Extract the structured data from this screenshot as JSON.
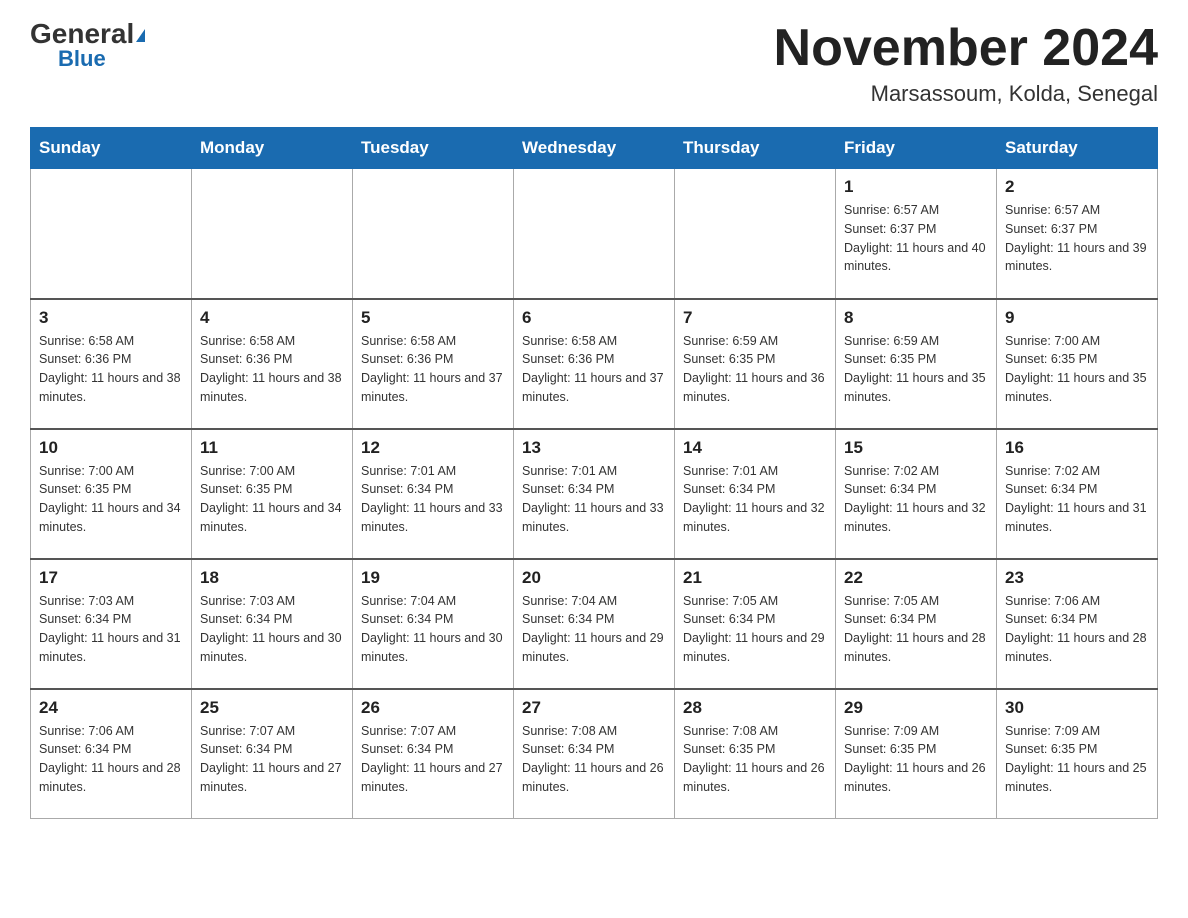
{
  "header": {
    "logo_general": "General",
    "logo_blue": "Blue",
    "title": "November 2024",
    "subtitle": "Marsassoum, Kolda, Senegal"
  },
  "days_of_week": [
    "Sunday",
    "Monday",
    "Tuesday",
    "Wednesday",
    "Thursday",
    "Friday",
    "Saturday"
  ],
  "weeks": [
    [
      {
        "day": "",
        "info": ""
      },
      {
        "day": "",
        "info": ""
      },
      {
        "day": "",
        "info": ""
      },
      {
        "day": "",
        "info": ""
      },
      {
        "day": "",
        "info": ""
      },
      {
        "day": "1",
        "info": "Sunrise: 6:57 AM\nSunset: 6:37 PM\nDaylight: 11 hours and 40 minutes."
      },
      {
        "day": "2",
        "info": "Sunrise: 6:57 AM\nSunset: 6:37 PM\nDaylight: 11 hours and 39 minutes."
      }
    ],
    [
      {
        "day": "3",
        "info": "Sunrise: 6:58 AM\nSunset: 6:36 PM\nDaylight: 11 hours and 38 minutes."
      },
      {
        "day": "4",
        "info": "Sunrise: 6:58 AM\nSunset: 6:36 PM\nDaylight: 11 hours and 38 minutes."
      },
      {
        "day": "5",
        "info": "Sunrise: 6:58 AM\nSunset: 6:36 PM\nDaylight: 11 hours and 37 minutes."
      },
      {
        "day": "6",
        "info": "Sunrise: 6:58 AM\nSunset: 6:36 PM\nDaylight: 11 hours and 37 minutes."
      },
      {
        "day": "7",
        "info": "Sunrise: 6:59 AM\nSunset: 6:35 PM\nDaylight: 11 hours and 36 minutes."
      },
      {
        "day": "8",
        "info": "Sunrise: 6:59 AM\nSunset: 6:35 PM\nDaylight: 11 hours and 35 minutes."
      },
      {
        "day": "9",
        "info": "Sunrise: 7:00 AM\nSunset: 6:35 PM\nDaylight: 11 hours and 35 minutes."
      }
    ],
    [
      {
        "day": "10",
        "info": "Sunrise: 7:00 AM\nSunset: 6:35 PM\nDaylight: 11 hours and 34 minutes."
      },
      {
        "day": "11",
        "info": "Sunrise: 7:00 AM\nSunset: 6:35 PM\nDaylight: 11 hours and 34 minutes."
      },
      {
        "day": "12",
        "info": "Sunrise: 7:01 AM\nSunset: 6:34 PM\nDaylight: 11 hours and 33 minutes."
      },
      {
        "day": "13",
        "info": "Sunrise: 7:01 AM\nSunset: 6:34 PM\nDaylight: 11 hours and 33 minutes."
      },
      {
        "day": "14",
        "info": "Sunrise: 7:01 AM\nSunset: 6:34 PM\nDaylight: 11 hours and 32 minutes."
      },
      {
        "day": "15",
        "info": "Sunrise: 7:02 AM\nSunset: 6:34 PM\nDaylight: 11 hours and 32 minutes."
      },
      {
        "day": "16",
        "info": "Sunrise: 7:02 AM\nSunset: 6:34 PM\nDaylight: 11 hours and 31 minutes."
      }
    ],
    [
      {
        "day": "17",
        "info": "Sunrise: 7:03 AM\nSunset: 6:34 PM\nDaylight: 11 hours and 31 minutes."
      },
      {
        "day": "18",
        "info": "Sunrise: 7:03 AM\nSunset: 6:34 PM\nDaylight: 11 hours and 30 minutes."
      },
      {
        "day": "19",
        "info": "Sunrise: 7:04 AM\nSunset: 6:34 PM\nDaylight: 11 hours and 30 minutes."
      },
      {
        "day": "20",
        "info": "Sunrise: 7:04 AM\nSunset: 6:34 PM\nDaylight: 11 hours and 29 minutes."
      },
      {
        "day": "21",
        "info": "Sunrise: 7:05 AM\nSunset: 6:34 PM\nDaylight: 11 hours and 29 minutes."
      },
      {
        "day": "22",
        "info": "Sunrise: 7:05 AM\nSunset: 6:34 PM\nDaylight: 11 hours and 28 minutes."
      },
      {
        "day": "23",
        "info": "Sunrise: 7:06 AM\nSunset: 6:34 PM\nDaylight: 11 hours and 28 minutes."
      }
    ],
    [
      {
        "day": "24",
        "info": "Sunrise: 7:06 AM\nSunset: 6:34 PM\nDaylight: 11 hours and 28 minutes."
      },
      {
        "day": "25",
        "info": "Sunrise: 7:07 AM\nSunset: 6:34 PM\nDaylight: 11 hours and 27 minutes."
      },
      {
        "day": "26",
        "info": "Sunrise: 7:07 AM\nSunset: 6:34 PM\nDaylight: 11 hours and 27 minutes."
      },
      {
        "day": "27",
        "info": "Sunrise: 7:08 AM\nSunset: 6:34 PM\nDaylight: 11 hours and 26 minutes."
      },
      {
        "day": "28",
        "info": "Sunrise: 7:08 AM\nSunset: 6:35 PM\nDaylight: 11 hours and 26 minutes."
      },
      {
        "day": "29",
        "info": "Sunrise: 7:09 AM\nSunset: 6:35 PM\nDaylight: 11 hours and 26 minutes."
      },
      {
        "day": "30",
        "info": "Sunrise: 7:09 AM\nSunset: 6:35 PM\nDaylight: 11 hours and 25 minutes."
      }
    ]
  ]
}
